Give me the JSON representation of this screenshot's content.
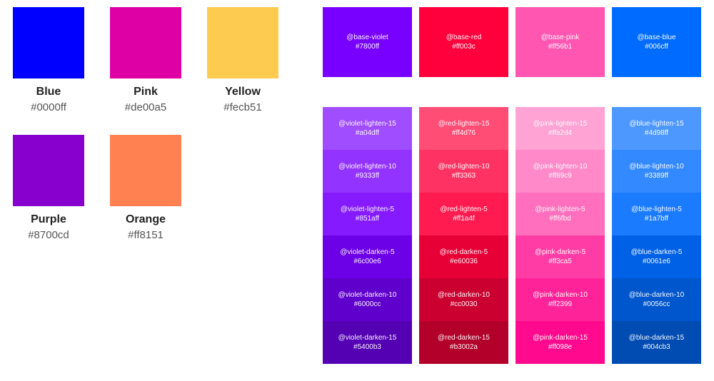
{
  "left_swatches": [
    {
      "name": "Blue",
      "hex": "#0000ff"
    },
    {
      "name": "Pink",
      "hex": "#de00a5"
    },
    {
      "name": "Yellow",
      "hex": "#fecb51"
    },
    {
      "name": "Purple",
      "hex": "#8700cd"
    },
    {
      "name": "Orange",
      "hex": "#ff8151"
    }
  ],
  "base_colors": [
    {
      "var": "@base-violet",
      "hex": "#7800ff"
    },
    {
      "var": "@base-red",
      "hex": "#ff003c"
    },
    {
      "var": "@base-pink",
      "hex": "#ff56b1"
    },
    {
      "var": "@base-blue",
      "hex": "#006cff"
    }
  ],
  "shade_columns": [
    {
      "family": "violet",
      "shades": [
        {
          "var": "@violet-lighten-15",
          "hex": "#a04dff"
        },
        {
          "var": "@violet-lighten-10",
          "hex": "#9333ff"
        },
        {
          "var": "@violet-lighten-5",
          "hex": "#851aff"
        },
        {
          "var": "@violet-darken-5",
          "hex": "#6c00e6"
        },
        {
          "var": "@violet-darken-10",
          "hex": "#6000cc"
        },
        {
          "var": "@violet-darken-15",
          "hex": "#5400b3"
        }
      ]
    },
    {
      "family": "red",
      "shades": [
        {
          "var": "@red-lighten-15",
          "hex": "#ff4d76"
        },
        {
          "var": "@red-lighten-10",
          "hex": "#ff3363"
        },
        {
          "var": "@red-lighten-5",
          "hex": "#ff1a4f"
        },
        {
          "var": "@red-darken-5",
          "hex": "#e60036"
        },
        {
          "var": "@red-darken-10",
          "hex": "#cc0030"
        },
        {
          "var": "@red-darken-15",
          "hex": "#b3002a"
        }
      ]
    },
    {
      "family": "pink",
      "shades": [
        {
          "var": "@pink-lighten-15",
          "hex": "#ffa2d4"
        },
        {
          "var": "@pink-lighten-10",
          "hex": "#ff89c9"
        },
        {
          "var": "@pink-lighten-5",
          "hex": "#ff6fbd"
        },
        {
          "var": "@pink-darken-5",
          "hex": "#ff3ca5"
        },
        {
          "var": "@pink-darken-10",
          "hex": "#ff2399"
        },
        {
          "var": "@pink-darken-15",
          "hex": "#ff098e"
        }
      ]
    },
    {
      "family": "blue",
      "shades": [
        {
          "var": "@blue-lighten-15",
          "hex": "#4d98ff"
        },
        {
          "var": "@blue-lighten-10",
          "hex": "#3389ff"
        },
        {
          "var": "@blue-lighten-5",
          "hex": "#1a7bff"
        },
        {
          "var": "@blue-darken-5",
          "hex": "#0061e6"
        },
        {
          "var": "@blue-darken-10",
          "hex": "#0056cc"
        },
        {
          "var": "@blue-darken-15",
          "hex": "#004cb3"
        }
      ]
    }
  ]
}
